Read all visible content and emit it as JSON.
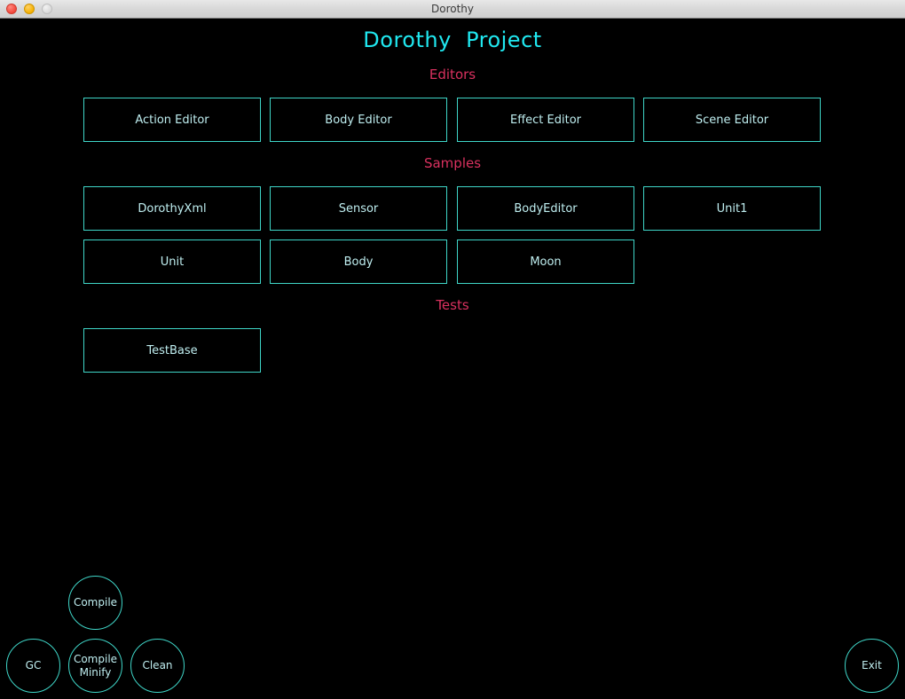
{
  "window": {
    "title": "Dorothy",
    "controls": [
      {
        "name": "close-button",
        "color": "#f2463a"
      },
      {
        "name": "minimize-button",
        "color": "#f4b000"
      },
      {
        "name": "zoom-button",
        "color": "#d9d9d9"
      }
    ]
  },
  "app": {
    "title": "Dorothy  Project",
    "accent_title_color": "#20e8f0",
    "section_label_color": "#d9315f",
    "button_border_color": "#3fd6c8",
    "button_text_color": "#bfeef0",
    "background_color": "#000000",
    "sections": [
      {
        "label": "Editors",
        "rows": [
          [
            "Action Editor",
            "Body Editor",
            "Effect Editor",
            "Scene Editor"
          ]
        ]
      },
      {
        "label": "Samples",
        "rows": [
          [
            "DorothyXml",
            "Sensor",
            "BodyEditor",
            "Unit1"
          ],
          [
            "Unit",
            "Body",
            "Moon"
          ]
        ]
      },
      {
        "label": "Tests",
        "rows": [
          [
            "TestBase"
          ]
        ]
      }
    ],
    "actions": {
      "compile": "Compile",
      "gc": "GC",
      "compile_minify": "Compile\nMinify",
      "clean": "Clean",
      "exit": "Exit"
    }
  }
}
